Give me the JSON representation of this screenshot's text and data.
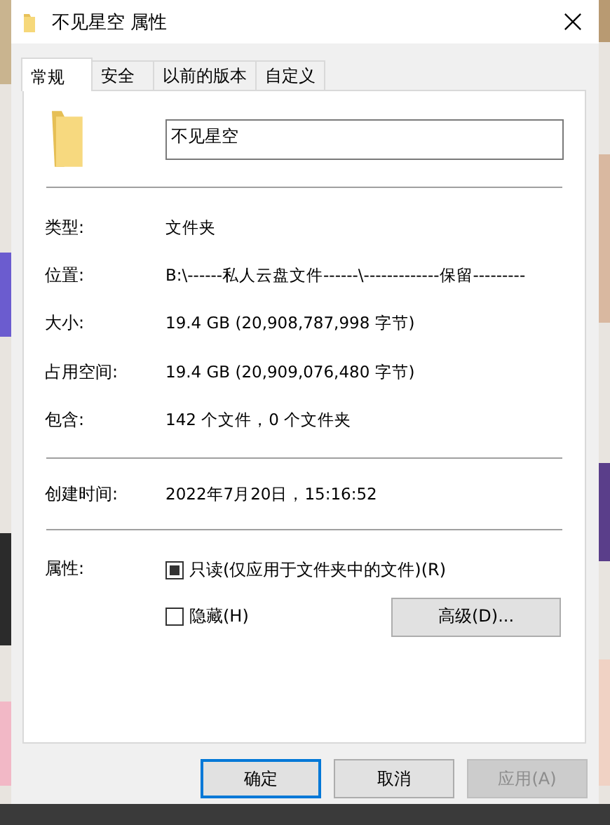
{
  "window": {
    "title": "不见星空 属性"
  },
  "tabs": [
    {
      "label": "常规",
      "selected": true
    },
    {
      "label": "安全",
      "selected": false
    },
    {
      "label": "以前的版本",
      "selected": false
    },
    {
      "label": "自定义",
      "selected": false
    }
  ],
  "name_field": {
    "value": "不见星空"
  },
  "groups": [
    [
      {
        "label": "类型:",
        "value": "文件夹"
      },
      {
        "label": "位置:",
        "value": "B:\\------私人云盘文件------\\-------------保留---------"
      },
      {
        "label": "大小:",
        "value": "19.4 GB (20,908,787,998 字节)"
      },
      {
        "label": "占用空间:",
        "value": "19.4 GB (20,909,076,480 字节)"
      },
      {
        "label": "包含:",
        "value": "142 个文件，0 个文件夹"
      }
    ],
    [
      {
        "label": "创建时间:",
        "value": "2022年7月20日，15:16:52"
      }
    ]
  ],
  "attributes": {
    "label": "属性:",
    "options": [
      {
        "label": "只读(仅应用于文件夹中的文件)(R)",
        "checked": false,
        "indeterminate": true
      },
      {
        "label": "隐藏(H)",
        "checked": false,
        "indeterminate": false
      }
    ],
    "advanced_button": "高级(D)..."
  },
  "buttons": [
    {
      "label": "确定",
      "default": true,
      "disabled": false
    },
    {
      "label": "取消",
      "default": false,
      "disabled": false
    },
    {
      "label": "应用(A)",
      "default": false,
      "disabled": true
    }
  ]
}
